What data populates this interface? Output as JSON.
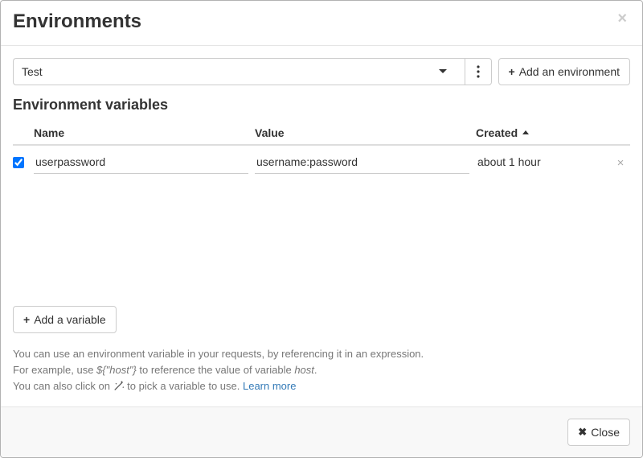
{
  "modal": {
    "title": "Environments"
  },
  "toolbar": {
    "selected_env": "Test",
    "add_env_label": "Add an environment"
  },
  "variables": {
    "heading": "Environment variables",
    "columns": {
      "name": "Name",
      "value": "Value",
      "created": "Created"
    },
    "rows": [
      {
        "checked": true,
        "name": "userpassword",
        "value": "username:password",
        "created": "about 1 hour"
      }
    ],
    "add_var_label": "Add a variable"
  },
  "help": {
    "line1": "You can use an environment variable in your requests, by referencing it in an expression.",
    "line2a": "For example, use ",
    "line2_expr": "${\"host\"}",
    "line2b": " to reference the value of variable ",
    "line2_var": "host",
    "line2c": ".",
    "line3a": "You can also click on ",
    "line3b": " to pick a variable to use. ",
    "learn_more": "Learn more"
  },
  "footer": {
    "close_label": "Close"
  }
}
